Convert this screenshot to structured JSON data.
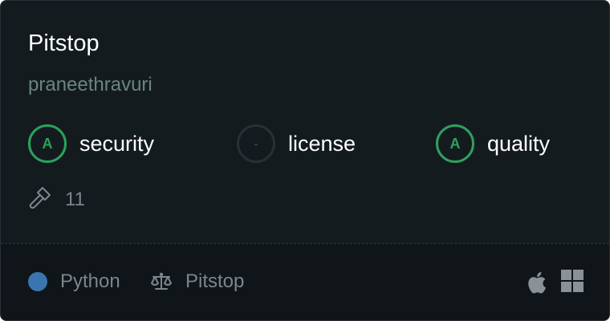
{
  "repo": {
    "name": "Pitstop",
    "owner": "praneethravuri"
  },
  "scores": [
    {
      "label": "security",
      "grade": "A"
    },
    {
      "label": "license",
      "grade": "-"
    },
    {
      "label": "quality",
      "grade": "A"
    }
  ],
  "builds": {
    "icon": "hammer-icon",
    "count": "11"
  },
  "footer": {
    "language": "Python",
    "language_color": "#3a75b0",
    "license_icon": "scale-icon",
    "license": "Pitstop",
    "platforms": [
      "apple-icon",
      "windows-icon"
    ]
  },
  "colors": {
    "grade_a": "#2ea05f",
    "background": "#141b1f"
  }
}
